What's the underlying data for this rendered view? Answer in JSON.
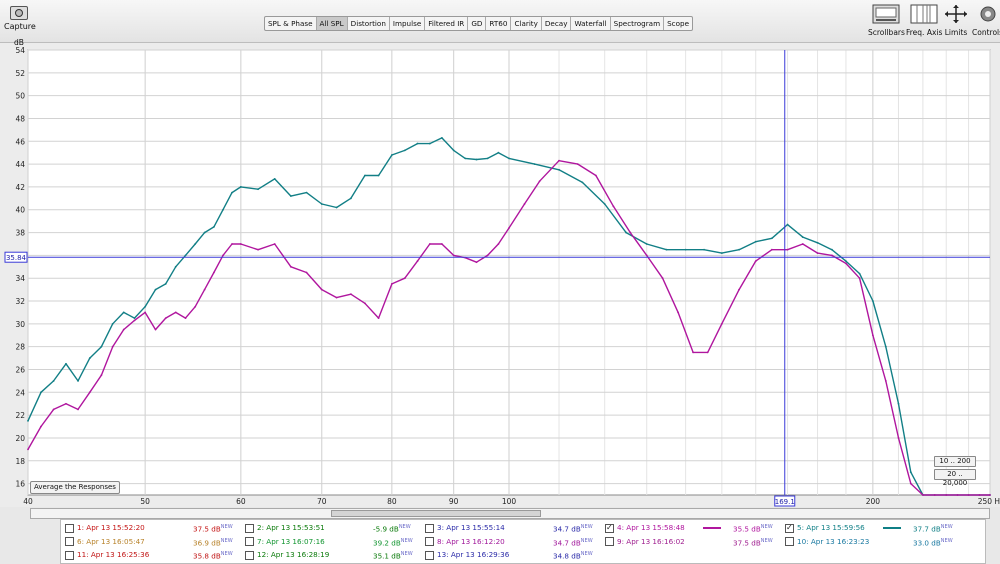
{
  "toolbar": {
    "capture_label": "Capture",
    "tabs": [
      "SPL & Phase",
      "All SPL",
      "Distortion",
      "Impulse",
      "Filtered IR",
      "GD",
      "RT60",
      "Clarity",
      "Decay",
      "Waterfall",
      "Spectrogram",
      "Scope"
    ],
    "active_tab": "All SPL",
    "right_tools": [
      "Scrollbars",
      "Freq. Axis",
      "Limits",
      "Controls"
    ]
  },
  "overlays": {
    "cursor_y_readout": "35.84",
    "cursor_x_readout": "169.1",
    "average_button": "Average the Responses",
    "range_buttons": [
      "10 .. 200",
      "20 .. 20,000"
    ]
  },
  "legend": {
    "rows": [
      [
        {
          "label": "1: Apr 13 15:52:20",
          "value": "37.5 dB",
          "checked": false,
          "color": "#c41414"
        },
        {
          "label": "2: Apr 13 15:53:51",
          "value": "-5.9 dB",
          "checked": false,
          "color": "#0a7a0a"
        },
        {
          "label": "3: Apr 13 15:55:14",
          "value": "34.7 dB",
          "checked": false,
          "color": "#2a2aa8"
        },
        {
          "label": "4: Apr 13 15:58:48",
          "value": "35.5 dB",
          "checked": true,
          "color": "#b0169e"
        },
        {
          "label": "5: Apr 13 15:59:56",
          "value": "37.7 dB",
          "checked": true,
          "color": "#0f7f86"
        }
      ],
      [
        {
          "label": "6: Apr 13 16:05:47",
          "value": "36.9 dB",
          "checked": false,
          "color": "#b7822a"
        },
        {
          "label": "7: Apr 13 16:07:16",
          "value": "39.2 dB",
          "checked": false,
          "color": "#10942f"
        },
        {
          "label": "8: Apr 13 16:12:20",
          "value": "34.7 dB",
          "checked": false,
          "color": "#a0169a"
        },
        {
          "label": "9: Apr 13 16:16:02",
          "value": "37.5 dB",
          "checked": false,
          "color": "#a02090"
        },
        {
          "label": "10: Apr 13 16:23:23",
          "value": "33.0 dB",
          "checked": false,
          "color": "#1878a0"
        }
      ],
      [
        {
          "label": "11: Apr 13 16:25:36",
          "value": "35.8 dB",
          "checked": false,
          "color": "#c01414"
        },
        {
          "label": "12: Apr 13 16:28:19",
          "value": "35.1 dB",
          "checked": false,
          "color": "#0a7a0a"
        },
        {
          "label": "13: Apr 13 16:29:36",
          "value": "34.8 dB",
          "checked": false,
          "color": "#2a2aa8"
        }
      ]
    ],
    "new_tag": "NEW"
  },
  "chart_data": {
    "type": "line",
    "title": "",
    "xlabel": "Hz",
    "ylabel": "dB",
    "x_scale": "log",
    "xlim": [
      40,
      250
    ],
    "ylim": [
      15,
      54
    ],
    "x_ticks": [
      40,
      50,
      60,
      70,
      80,
      90,
      100,
      200,
      250
    ],
    "x_tick_labels": [
      "40",
      "50",
      "60",
      "70",
      "80",
      "90",
      "100",
      "200",
      "250 Hz"
    ],
    "y_ticks": [
      16,
      18,
      20,
      22,
      24,
      26,
      28,
      30,
      32,
      34,
      36,
      38,
      40,
      42,
      44,
      46,
      48,
      50,
      52,
      54
    ],
    "y_tick_labels": [
      "16",
      "18",
      "20",
      "22",
      "24",
      "26",
      "28",
      "30",
      "32",
      "34",
      "36",
      "38",
      "40",
      "42",
      "44",
      "46",
      "48",
      "50",
      "52",
      "54"
    ],
    "grid": true,
    "cursor": {
      "x": 169.1,
      "y": 35.84
    },
    "series": [
      {
        "name": "5: Apr 13 15:59:56",
        "color": "#127f86",
        "x": [
          40,
          41,
          42,
          43,
          44,
          45,
          46,
          47,
          48,
          49,
          50,
          51,
          52,
          53,
          54,
          55,
          56,
          57,
          58,
          59,
          60,
          62,
          64,
          66,
          68,
          70,
          72,
          74,
          76,
          78,
          80,
          82,
          84,
          86,
          88,
          90,
          92,
          94,
          96,
          98,
          100,
          105,
          110,
          115,
          120,
          125,
          130,
          135,
          140,
          145,
          150,
          155,
          160,
          165,
          170,
          175,
          180,
          185,
          190,
          195,
          200,
          205,
          210,
          215,
          220,
          225,
          230,
          235,
          240,
          245,
          250
        ],
        "y": [
          21.5,
          24,
          25,
          26.5,
          25,
          27,
          28,
          30,
          31,
          30.5,
          31.5,
          33,
          33.5,
          35,
          36,
          37,
          38,
          38.5,
          40,
          41.5,
          42,
          41.8,
          42.7,
          41.2,
          41.5,
          40.5,
          40.2,
          41,
          43,
          43,
          44.8,
          45.2,
          45.8,
          45.8,
          46.3,
          45.2,
          44.5,
          44.4,
          44.5,
          45,
          44.5,
          44,
          43.5,
          42.4,
          40.5,
          38,
          37,
          36.5,
          36.5,
          36.5,
          36.2,
          36.5,
          37.2,
          37.5,
          38.7,
          37.6,
          37.1,
          36.5,
          35.5,
          34.4,
          32,
          28,
          23,
          17,
          15,
          15,
          15,
          15,
          15,
          15,
          15
        ]
      },
      {
        "name": "4: Apr 13 15:58:48",
        "color": "#b0169e",
        "x": [
          40,
          41,
          42,
          43,
          44,
          45,
          46,
          47,
          48,
          49,
          50,
          51,
          52,
          53,
          54,
          55,
          56,
          57,
          58,
          59,
          60,
          62,
          64,
          66,
          68,
          70,
          72,
          74,
          76,
          78,
          80,
          82,
          84,
          86,
          88,
          90,
          92,
          94,
          96,
          98,
          100,
          103,
          106,
          110,
          114,
          118,
          122,
          126,
          130,
          134,
          138,
          142,
          146,
          150,
          155,
          160,
          165,
          170,
          175,
          180,
          185,
          190,
          195,
          200,
          205,
          210,
          215,
          220,
          225,
          230,
          235,
          240,
          245,
          250
        ],
        "y": [
          19,
          21,
          22.5,
          23,
          22.5,
          24,
          25.5,
          28,
          29.5,
          30.3,
          31,
          29.5,
          30.5,
          31,
          30.5,
          31.5,
          33,
          34.5,
          36,
          37,
          37,
          36.5,
          37,
          35,
          34.5,
          33,
          32.3,
          32.6,
          31.8,
          30.5,
          33.5,
          34,
          35.5,
          37,
          37,
          36,
          35.8,
          35.4,
          36,
          37,
          38.4,
          40.5,
          42.5,
          44.3,
          44,
          43,
          40.3,
          38,
          36,
          34,
          31,
          27.5,
          27.5,
          30,
          33,
          35.5,
          36.5,
          36.5,
          37,
          36.2,
          36,
          35.3,
          34,
          29,
          25,
          20,
          16,
          15,
          15,
          15,
          15,
          15,
          15,
          15
        ]
      }
    ]
  }
}
